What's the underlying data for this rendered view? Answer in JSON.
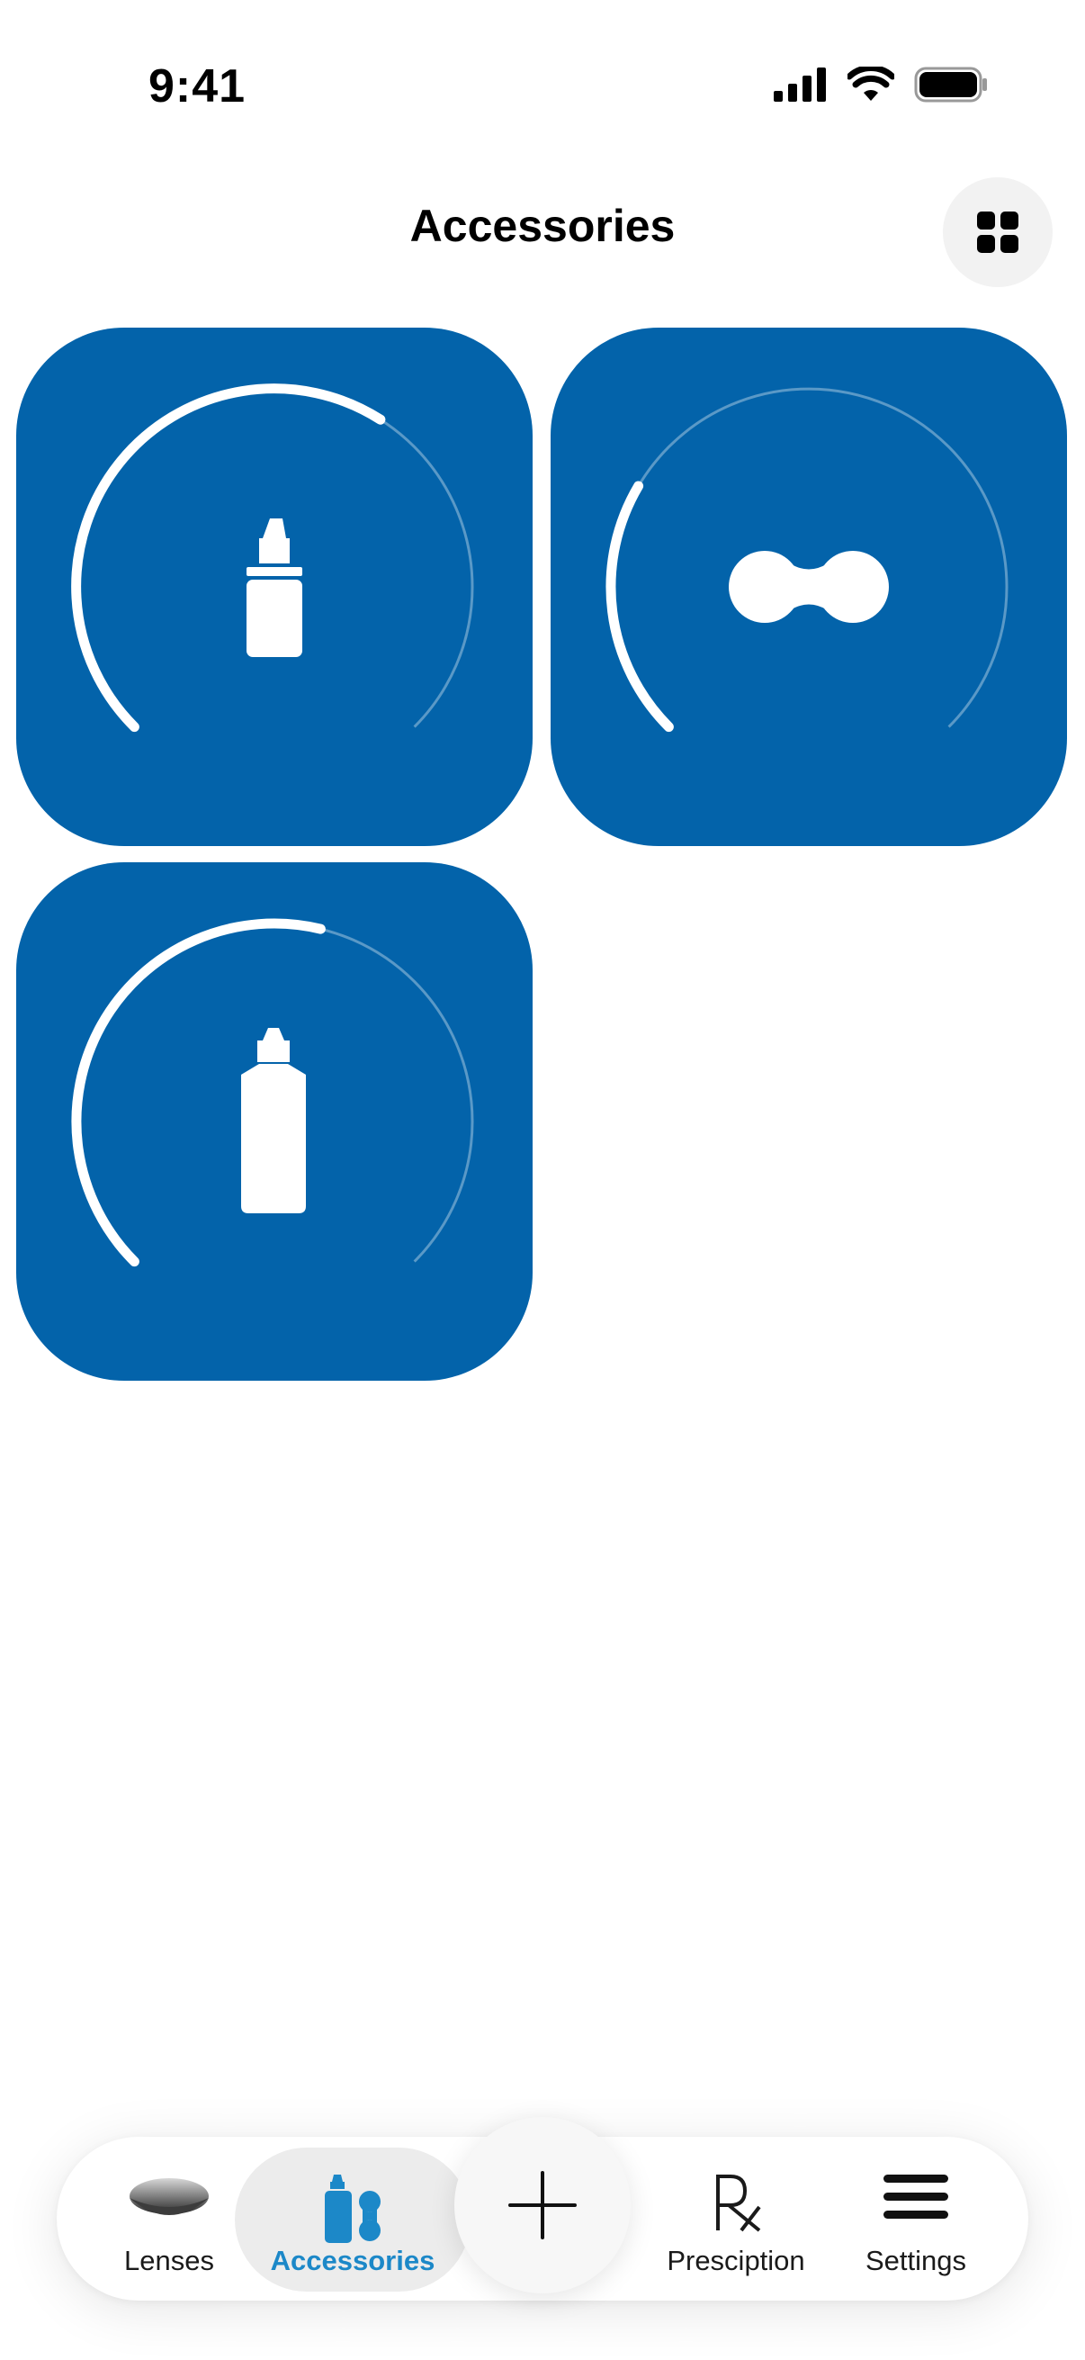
{
  "status_bar": {
    "time": "9:41"
  },
  "header": {
    "title": "Accessories",
    "layout_toggle_icon": "grid-icon"
  },
  "tiles": [
    {
      "item": "eye drops bottle",
      "icon": "eye-drops-icon",
      "progress": 0.62
    },
    {
      "item": "lens case",
      "icon": "lens-case-icon",
      "progress": 0.28
    },
    {
      "item": "solution bottle",
      "icon": "solution-bottle-icon",
      "progress": 0.55
    }
  ],
  "colors": {
    "tile_background": "#0363AA",
    "accent": "#1C88C8",
    "ring_active": "#FFFFFF"
  },
  "tab_bar": {
    "tabs": [
      {
        "label": "Lenses",
        "icon": "lens-icon",
        "active": false
      },
      {
        "label": "Accessories",
        "icon": "accessories-icon",
        "active": true
      },
      {
        "label": "Presciption",
        "icon": "rx-icon",
        "active": false
      },
      {
        "label": "Settings",
        "icon": "hamburger-icon",
        "active": false
      }
    ],
    "add_icon": "plus-icon"
  }
}
